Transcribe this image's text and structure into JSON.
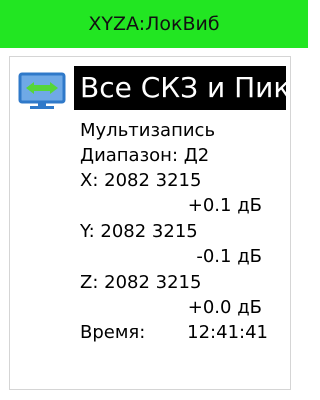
{
  "window": {
    "title": "XYZA:ЛокВиб"
  },
  "mode": {
    "icon": "vibration-monitor-icon",
    "title": "Все СКЗ и Пик"
  },
  "measurement": {
    "mode_label": "Мультизапись",
    "range_label": "Диапазон: Д2",
    "x": {
      "line": "X: 2082 3215",
      "delta": "+0.1 дБ"
    },
    "y": {
      "line": "Y: 2082 3215",
      "delta": "-0.1 дБ"
    },
    "z": {
      "line": "Z: 2082 3215",
      "delta": "+0.0 дБ"
    },
    "time": {
      "label": "Время:",
      "value": "12:41:41"
    }
  },
  "colors": {
    "title_bar": "#22e622",
    "header_bg": "#000000",
    "header_text": "#ffffff",
    "icon_monitor": "#2f79c9",
    "icon_arrows": "#55d63a"
  }
}
